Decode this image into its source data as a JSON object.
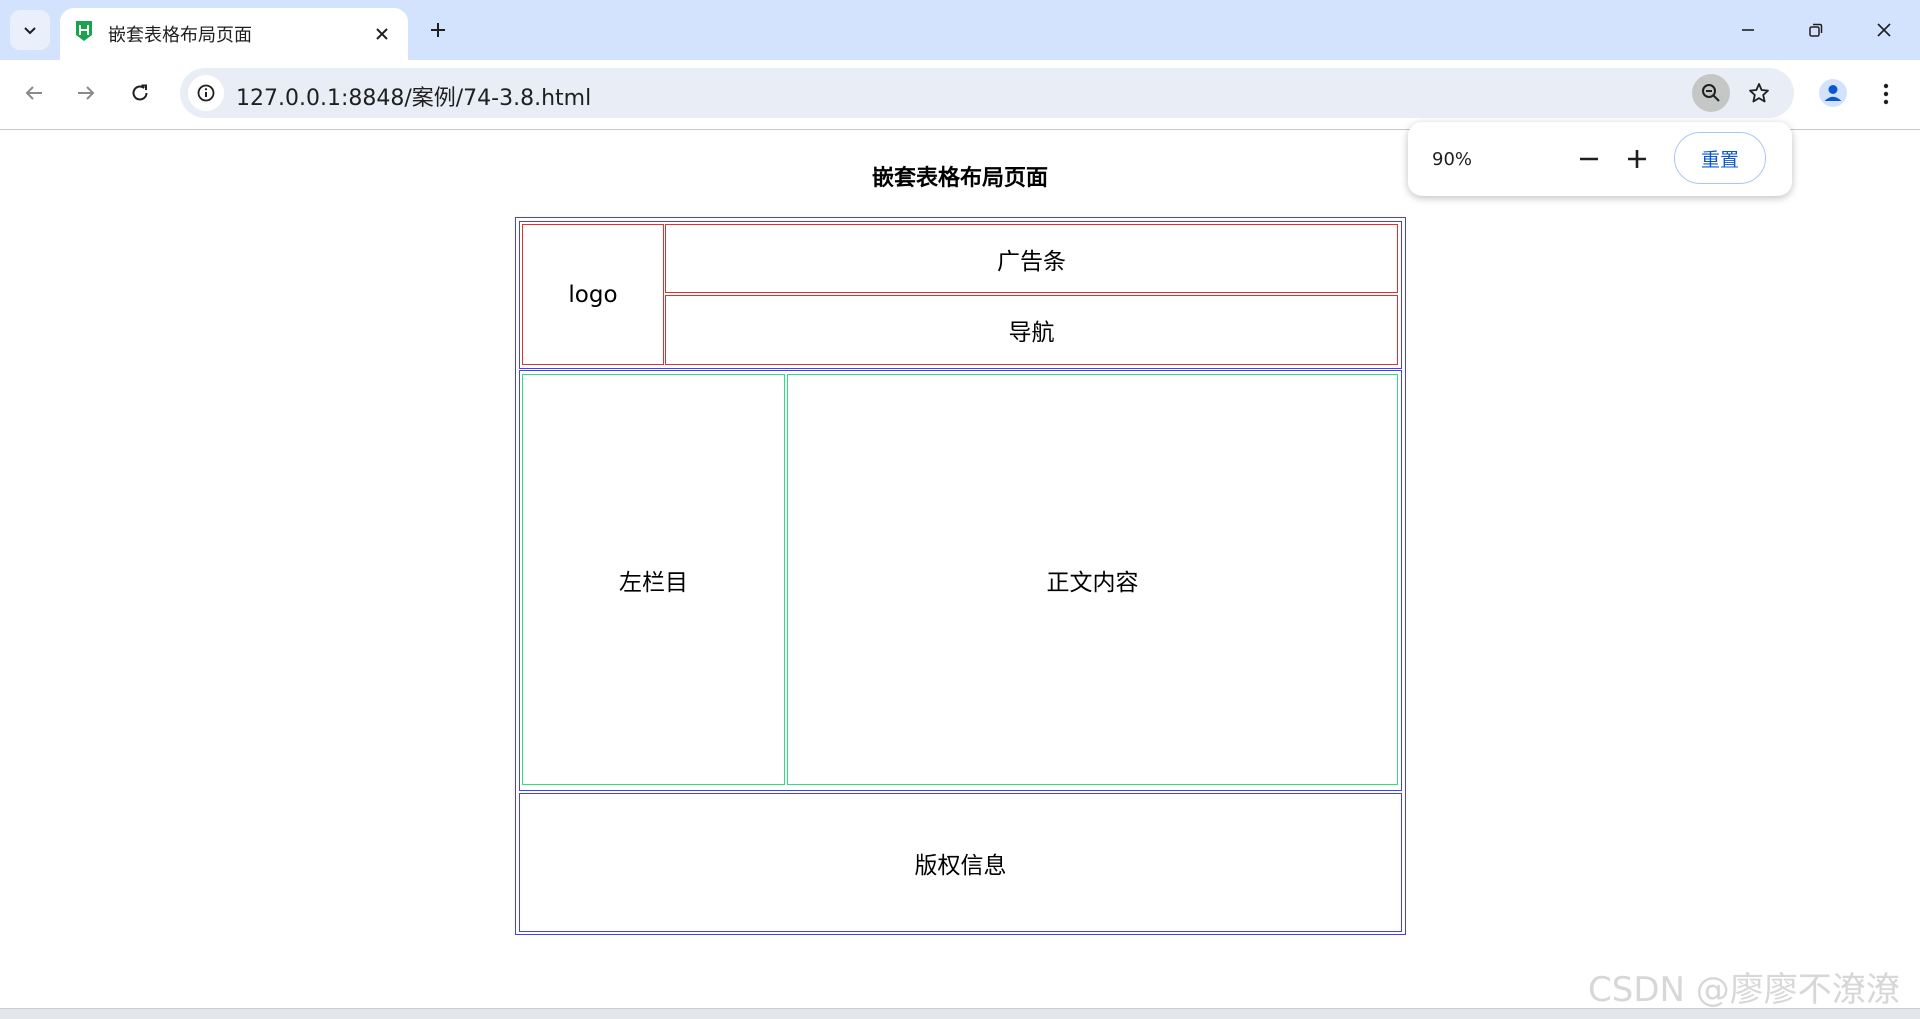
{
  "browser": {
    "tab": {
      "title": "嵌套表格布局页面"
    },
    "address_bar": {
      "url": "127.0.0.1:8848/案例/74-3.8.html"
    },
    "zoom_popup": {
      "value": "90%",
      "reset_label": "重置"
    },
    "colors": {
      "tabstrip": "#d3e3fd",
      "omnibox": "#e9eef6",
      "accent": "#0b57d0",
      "favicon": "#1aa34a"
    }
  },
  "page": {
    "title": "嵌套表格布局页面",
    "header": {
      "logo": "logo",
      "banner": "广告条",
      "nav": "导航"
    },
    "body": {
      "left_column": "左栏目",
      "main_content": "正文内容"
    },
    "footer": {
      "copyright": "版权信息"
    },
    "colors": {
      "outer_border": "#4040ff",
      "header_border": "#e03030",
      "body_border": "#30e080"
    }
  },
  "watermark": "CSDN @廖廖不潦潦"
}
